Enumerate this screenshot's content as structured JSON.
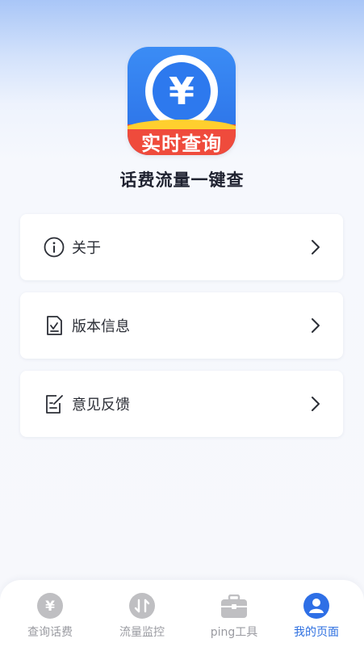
{
  "app": {
    "icon_symbol": "¥",
    "icon_banner_text": "实时查询",
    "name": "话费流量一键查"
  },
  "menu": [
    {
      "label": "关于",
      "icon": "info-circle-icon"
    },
    {
      "label": "版本信息",
      "icon": "document-check-icon"
    },
    {
      "label": "意见反馈",
      "icon": "edit-note-icon"
    }
  ],
  "tabbar": {
    "tabs": [
      {
        "label": "查询话费",
        "icon": "yuan-coin-icon",
        "active": false
      },
      {
        "label": "流量监控",
        "icon": "up-down-arrows-icon",
        "active": false
      },
      {
        "label": "ping工具",
        "icon": "toolbox-icon",
        "active": false
      },
      {
        "label": "我的页面",
        "icon": "user-profile-icon",
        "active": true
      }
    ]
  },
  "colors": {
    "accent": "#2e6fe6",
    "inactive": "#bfbfc2",
    "banner_red": "#ef4b3c"
  }
}
